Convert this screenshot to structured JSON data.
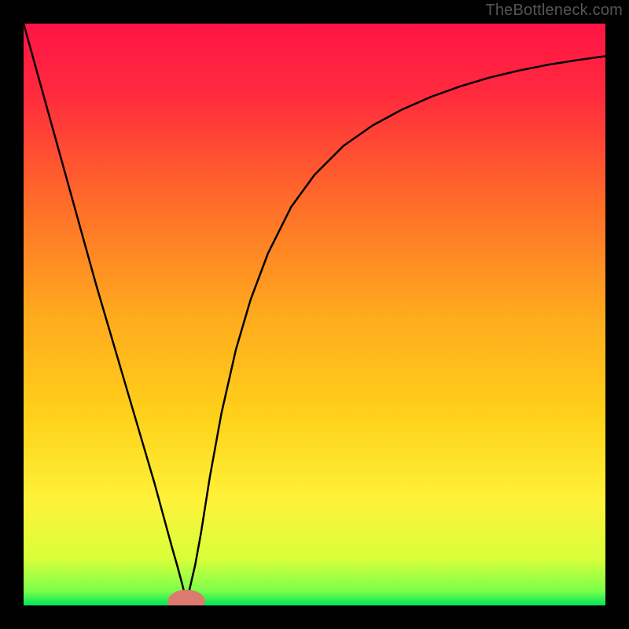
{
  "watermark": "TheBottleneck.com",
  "chart_data": {
    "type": "line",
    "title": "",
    "xlabel": "",
    "ylabel": "",
    "xlim": [
      0,
      100
    ],
    "ylim": [
      0,
      100
    ],
    "gradient_stops": [
      {
        "offset": 0.0,
        "color": "#ff1445"
      },
      {
        "offset": 0.12,
        "color": "#ff2a3e"
      },
      {
        "offset": 0.3,
        "color": "#ff6a2a"
      },
      {
        "offset": 0.5,
        "color": "#ffaa1e"
      },
      {
        "offset": 0.68,
        "color": "#ffd21a"
      },
      {
        "offset": 0.82,
        "color": "#fff23a"
      },
      {
        "offset": 0.92,
        "color": "#d8ff3a"
      },
      {
        "offset": 0.975,
        "color": "#7bff4a"
      },
      {
        "offset": 1.0,
        "color": "#00e65a"
      }
    ],
    "series": [
      {
        "name": "bottleneck-curve",
        "stroke": "#000000",
        "x": [
          0.0,
          2.5,
          5.0,
          7.5,
          10.0,
          12.5,
          15.0,
          17.5,
          20.0,
          22.5,
          24.0,
          25.5,
          26.5,
          27.3,
          28.0,
          28.7,
          29.5,
          30.5,
          32.0,
          34.0,
          36.5,
          39.0,
          42.0,
          46.0,
          50.0,
          55.0,
          60.0,
          65.0,
          70.0,
          75.0,
          80.0,
          85.0,
          90.0,
          95.0,
          100.0
        ],
        "y": [
          100.0,
          91.0,
          82.0,
          73.0,
          64.0,
          55.0,
          46.5,
          38.0,
          29.5,
          21.0,
          15.5,
          10.0,
          6.5,
          3.5,
          0.7,
          3.5,
          7.0,
          12.5,
          22.0,
          33.0,
          44.0,
          52.5,
          60.5,
          68.5,
          74.0,
          79.0,
          82.5,
          85.2,
          87.4,
          89.2,
          90.7,
          91.9,
          92.9,
          93.7,
          94.4
        ]
      }
    ],
    "marker": {
      "x": 28.0,
      "y": 0.7,
      "rx": 3.2,
      "ry": 2.0,
      "fill": "#dd7a6f"
    }
  }
}
